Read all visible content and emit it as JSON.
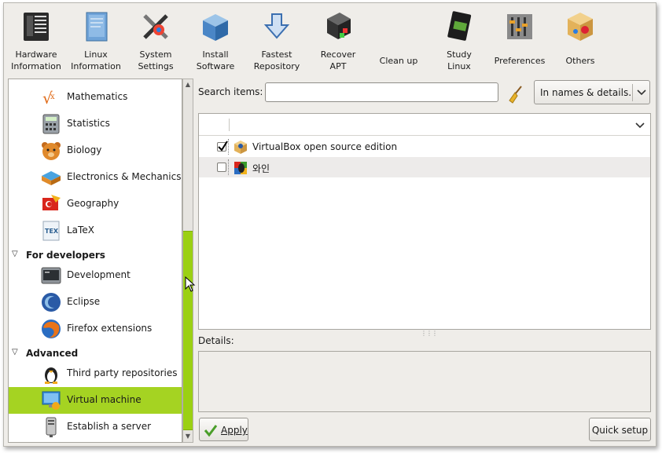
{
  "toolbar": {
    "items": [
      {
        "label": "Hardware\nInformation",
        "icon": "hardware-chip-icon"
      },
      {
        "label": "Linux\nInformation",
        "icon": "document-icon"
      },
      {
        "label": "System\nSettings",
        "icon": "tools-icon"
      },
      {
        "label": "Install\nSoftware",
        "icon": "package-icon"
      },
      {
        "label": "Fastest\nRepository",
        "icon": "download-arrow-icon"
      },
      {
        "label": "Recover\nAPT",
        "icon": "recover-box-icon"
      },
      {
        "label": "Clean up",
        "icon": "clean-up-icon"
      },
      {
        "label": "Study\nLinux",
        "icon": "book-icon"
      },
      {
        "label": "Preferences",
        "icon": "sliders-icon"
      },
      {
        "label": "Others",
        "icon": "gears-box-icon"
      }
    ]
  },
  "sidebar": {
    "items": [
      {
        "label": "Mathematics",
        "icon": "math-icon"
      },
      {
        "label": "Statistics",
        "icon": "calculator-icon"
      },
      {
        "label": "Biology",
        "icon": "bear-icon"
      },
      {
        "label": "Electronics & Mechanics",
        "icon": "chip-icon"
      },
      {
        "label": "Geography",
        "icon": "flag-map-icon"
      },
      {
        "label": "LaTeX",
        "icon": "tex-icon"
      }
    ],
    "groups": [
      {
        "label": "For developers",
        "items": [
          {
            "label": "Development",
            "icon": "terminal-icon"
          },
          {
            "label": "Eclipse",
            "icon": "eclipse-icon"
          },
          {
            "label": "Firefox extensions",
            "icon": "firefox-icon"
          }
        ]
      },
      {
        "label": "Advanced",
        "items": [
          {
            "label": "Third party repositories",
            "icon": "penguin-icon"
          },
          {
            "label": "Virtual machine",
            "icon": "virtual-machine-icon",
            "selected": true
          },
          {
            "label": "Establish a server",
            "icon": "server-icon"
          }
        ]
      }
    ]
  },
  "search": {
    "label": "Search items:",
    "value": "",
    "placeholder": ""
  },
  "filter": {
    "selected": "In names & details."
  },
  "items": [
    {
      "label": "VirtualBox open source edition",
      "checked": true,
      "icon": "virtualbox-icon"
    },
    {
      "label": "와인",
      "checked": false,
      "icon": "wine-icon"
    }
  ],
  "details": {
    "label": "Details:",
    "text": ""
  },
  "buttons": {
    "apply": "Apply",
    "quick_setup": "Quick setup"
  },
  "colors": {
    "accent": "#a5d322",
    "scroll_thumb": "#9bd013",
    "window_bg": "#efede9"
  }
}
